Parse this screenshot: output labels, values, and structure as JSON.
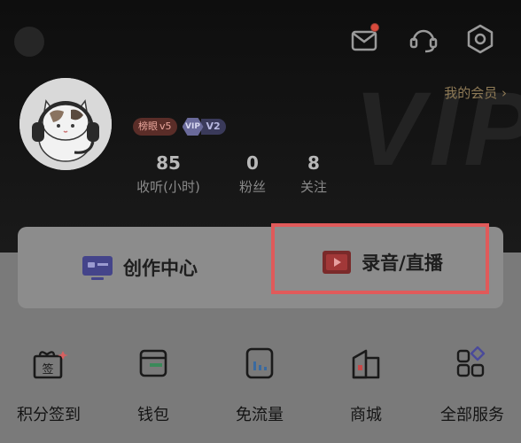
{
  "header": {
    "member_link": "我的会员",
    "member_chevron": "›",
    "bg_watermark": "VIP",
    "badges": {
      "vip5_label": "榜眼",
      "vip5_level": "v5",
      "vip_icon": "VIP",
      "vip_level": "V2"
    }
  },
  "stats": [
    {
      "value": "85",
      "label": "收听(小时)"
    },
    {
      "value": "0",
      "label": "粉丝"
    },
    {
      "value": "8",
      "label": "关注"
    }
  ],
  "actions": {
    "create_label": "创作中心",
    "record_label": "录音/直播"
  },
  "grid": [
    {
      "label": "积分签到",
      "icon_text": "签"
    },
    {
      "label": "钱包"
    },
    {
      "label": "免流量"
    },
    {
      "label": "商城"
    },
    {
      "label": "全部服务"
    }
  ],
  "icons": {
    "top_right": [
      "mail-icon",
      "headset-icon",
      "settings-icon"
    ],
    "grid": [
      "gift-signin-icon",
      "wallet-icon",
      "data-saver-icon",
      "mall-icon",
      "all-services-icon"
    ]
  },
  "colors": {
    "accent_red": "#e05a5a",
    "member_gold": "#8e7a56",
    "notification": "#d94a3c"
  }
}
